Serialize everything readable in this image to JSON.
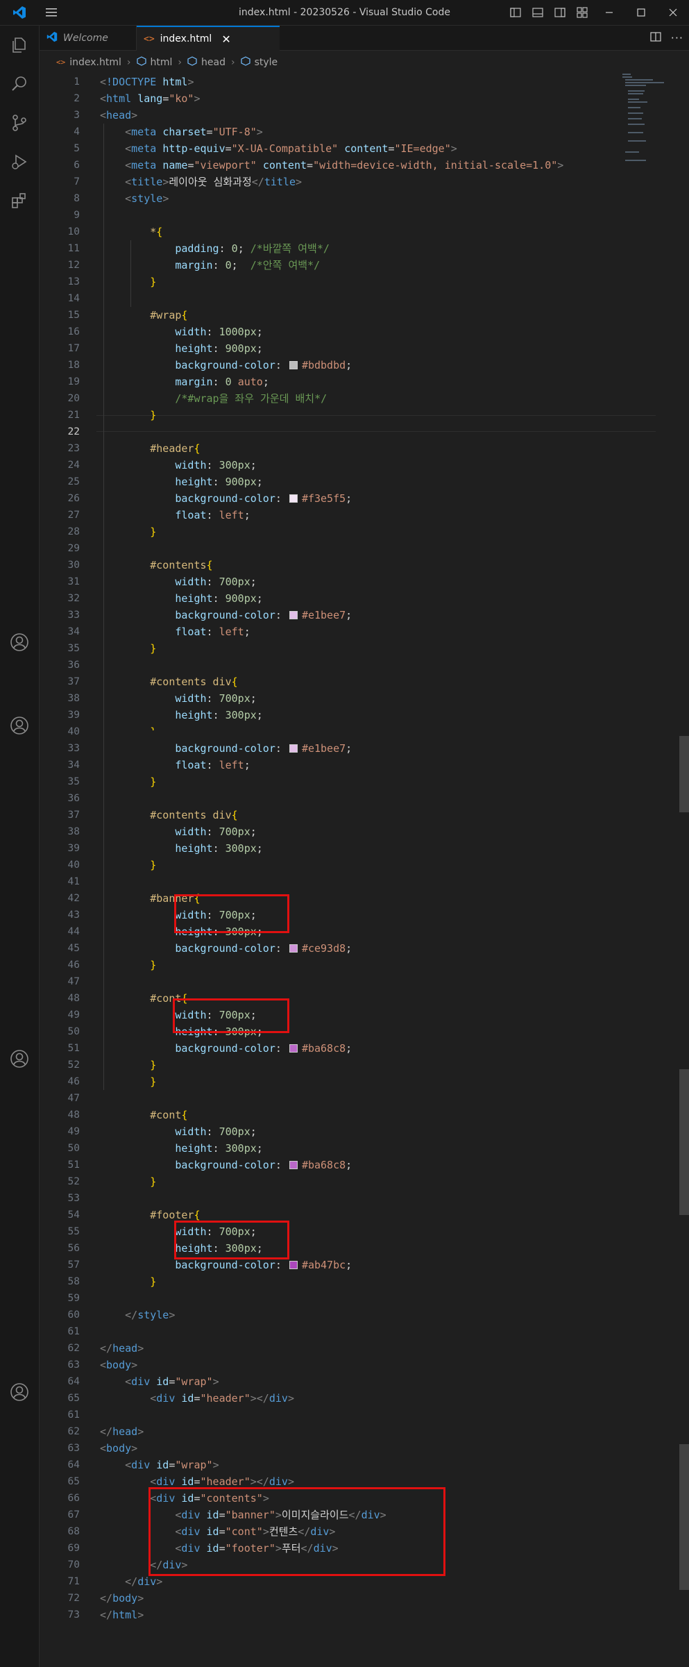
{
  "window": {
    "title": "index.html - 20230526 - Visual Studio Code"
  },
  "tabs": [
    {
      "label": "Welcome",
      "active": false
    },
    {
      "label": "index.html",
      "active": true
    }
  ],
  "breadcrumb": [
    "index.html",
    "html",
    "head",
    "style"
  ],
  "colors": {
    "accent": "#0078d4",
    "highlight_box": "#e01010"
  },
  "editor": {
    "lines": [
      {
        "n": "1",
        "html": "<span class='t'>&lt;</span><span class='tg'>!DOCTYPE</span> <span class='at'>html</span><span class='t'>&gt;</span>"
      },
      {
        "n": "2",
        "html": "<span class='t'>&lt;</span><span class='tg'>html</span> <span class='at'>lang</span><span class='pl'>=</span><span class='st'>\"ko\"</span><span class='t'>&gt;</span>"
      },
      {
        "n": "3",
        "html": "<span class='t'>&lt;</span><span class='tg'>head</span><span class='t'>&gt;</span>"
      },
      {
        "n": "4",
        "html": "    <span class='t'>&lt;</span><span class='tg'>meta</span> <span class='at'>charset</span><span class='pl'>=</span><span class='st'>\"UTF-8\"</span><span class='t'>&gt;</span>"
      },
      {
        "n": "5",
        "html": "    <span class='t'>&lt;</span><span class='tg'>meta</span> <span class='at'>http-equiv</span><span class='pl'>=</span><span class='st'>\"X-UA-Compatible\"</span> <span class='at'>content</span><span class='pl'>=</span><span class='st'>\"IE=edge\"</span><span class='t'>&gt;</span>"
      },
      {
        "n": "6",
        "html": "    <span class='t'>&lt;</span><span class='tg'>meta</span> <span class='at'>name</span><span class='pl'>=</span><span class='st'>\"viewport\"</span> <span class='at'>content</span><span class='pl'>=</span><span class='st'>\"width=device-width, initial-scale=1.0\"</span><span class='t'>&gt;</span>"
      },
      {
        "n": "7",
        "html": "    <span class='t'>&lt;</span><span class='tg'>title</span><span class='t'>&gt;</span><span class='pl'>레이아웃 심화과정</span><span class='t'>&lt;/</span><span class='tg'>title</span><span class='t'>&gt;</span>"
      },
      {
        "n": "8",
        "html": "    <span class='t'>&lt;</span><span class='tg'>style</span><span class='t'>&gt;</span>"
      },
      {
        "n": "9",
        "html": ""
      },
      {
        "n": "10",
        "html": "        <span class='sel'>*</span><span class='br'>{</span>"
      },
      {
        "n": "11",
        "html": "            <span class='pr'>padding</span><span class='pl'>: </span><span class='nu'>0</span><span class='pl'>; </span><span class='cm'>/*바깥쪽 여백*/</span>"
      },
      {
        "n": "12",
        "html": "            <span class='pr'>margin</span><span class='pl'>: </span><span class='nu'>0</span><span class='pl'>;  </span><span class='cm'>/*안쪽 여백*/</span>"
      },
      {
        "n": "13",
        "html": "        <span class='br'>}</span>"
      },
      {
        "n": "14",
        "html": ""
      },
      {
        "n": "15",
        "html": "        <span class='sel'>#wrap</span><span class='br'>{</span>"
      },
      {
        "n": "16",
        "html": "            <span class='pr'>width</span><span class='pl'>: </span><span class='nu'>1000px</span><span class='pl'>;</span>"
      },
      {
        "n": "17",
        "html": "            <span class='pr'>height</span><span class='pl'>: </span><span class='nu'>900px</span><span class='pl'>;</span>"
      },
      {
        "n": "18",
        "html": "            <span class='pr'>background-color</span><span class='pl'>: </span><span class='sw' style='background:#bdbdbd'></span><span class='st'>#bdbdbd</span><span class='pl'>;</span>"
      },
      {
        "n": "19",
        "html": "            <span class='pr'>margin</span><span class='pl'>: </span><span class='nu'>0</span><span class='pl'> </span><span class='kw'>auto</span><span class='pl'>;</span>"
      },
      {
        "n": "20",
        "html": "            <span class='cm'>/*#wrap을 좌우 가운데 배치*/</span>"
      },
      {
        "n": "21",
        "html": "        <span class='br'>}</span>"
      },
      {
        "n": "22",
        "html": "",
        "cur": true
      },
      {
        "n": "23",
        "html": "        <span class='sel'>#header</span><span class='br'>{</span>"
      },
      {
        "n": "24",
        "html": "            <span class='pr'>width</span><span class='pl'>: </span><span class='nu'>300px</span><span class='pl'>;</span>"
      },
      {
        "n": "25",
        "html": "            <span class='pr'>height</span><span class='pl'>: </span><span class='nu'>900px</span><span class='pl'>;</span>"
      },
      {
        "n": "26",
        "html": "            <span class='pr'>background-color</span><span class='pl'>: </span><span class='sw' style='background:#f3e5f5'></span><span class='st'>#f3e5f5</span><span class='pl'>;</span>"
      },
      {
        "n": "27",
        "html": "            <span class='pr'>float</span><span class='pl'>: </span><span class='kw'>left</span><span class='pl'>;</span>"
      },
      {
        "n": "28",
        "html": "        <span class='br'>}</span>"
      },
      {
        "n": "29",
        "html": ""
      },
      {
        "n": "30",
        "html": "        <span class='sel'>#contents</span><span class='br'>{</span>"
      },
      {
        "n": "31",
        "html": "            <span class='pr'>width</span><span class='pl'>: </span><span class='nu'>700px</span><span class='pl'>;</span>"
      },
      {
        "n": "32",
        "html": "            <span class='pr'>height</span><span class='pl'>: </span><span class='nu'>900px</span><span class='pl'>;</span>"
      },
      {
        "n": "33",
        "html": "            <span class='pr'>background-color</span><span class='pl'>: </span><span class='sw' style='background:#e1bee7'></span><span class='st'>#e1bee7</span><span class='pl'>;</span>"
      },
      {
        "n": "34",
        "html": "            <span class='pr'>float</span><span class='pl'>: </span><span class='kw'>left</span><span class='pl'>;</span>"
      },
      {
        "n": "35",
        "html": "        <span class='br'>}</span>"
      },
      {
        "n": "36",
        "html": ""
      },
      {
        "n": "37",
        "html": "        <span class='sel'>#contents div</span><span class='br'>{</span>"
      },
      {
        "n": "38",
        "html": "            <span class='pr'>width</span><span class='pl'>: </span><span class='nu'>700px</span><span class='pl'>;</span>"
      },
      {
        "n": "39",
        "html": "            <span class='pr'>height</span><span class='pl'>: </span><span class='nu'>300px</span><span class='pl'>;</span>"
      },
      {
        "n": "40",
        "html": "        <span class='br'>}</span>",
        "glitch": true
      },
      {
        "n": "33",
        "html": "            <span class='pr'>background-color</span><span class='pl'>: </span><span class='sw' style='background:#e1bee7'></span><span class='st'>#e1bee7</span><span class='pl'>;</span>"
      },
      {
        "n": "34",
        "html": "            <span class='pr'>float</span><span class='pl'>: </span><span class='kw'>left</span><span class='pl'>;</span>"
      },
      {
        "n": "35",
        "html": "        <span class='br'>}</span>"
      },
      {
        "n": "36",
        "html": ""
      },
      {
        "n": "37",
        "html": "        <span class='sel'>#contents div</span><span class='br'>{</span>"
      },
      {
        "n": "38",
        "html": "            <span class='pr'>width</span><span class='pl'>: </span><span class='nu'>700px</span><span class='pl'>;</span>"
      },
      {
        "n": "39",
        "html": "            <span class='pr'>height</span><span class='pl'>: </span><span class='nu'>300px</span><span class='pl'>;</span>"
      },
      {
        "n": "40",
        "html": "        <span class='br'>}</span>"
      },
      {
        "n": "41",
        "html": ""
      },
      {
        "n": "42",
        "html": "        <span class='sel'>#banner</span><span class='br'>{</span>"
      },
      {
        "n": "43",
        "html": "            <span class='pr'>width</span><span class='pl'>: </span><span class='nu'>700px</span><span class='pl'>;</span>"
      },
      {
        "n": "44",
        "html": "            <span class='pr'>height</span><span class='pl'>: </span><span class='nu'>300px</span><span class='pl'>;</span>"
      },
      {
        "n": "45",
        "html": "            <span class='pr'>background-color</span><span class='pl'>: </span><span class='sw' style='background:#ce93d8'></span><span class='st'>#ce93d8</span><span class='pl'>;</span>"
      },
      {
        "n": "46",
        "html": "        <span class='br'>}</span>"
      },
      {
        "n": "47",
        "html": ""
      },
      {
        "n": "48",
        "html": "        <span class='sel'>#cont</span><span class='br'>{</span>"
      },
      {
        "n": "49",
        "html": "            <span class='pr'>width</span><span class='pl'>: </span><span class='nu'>700px</span><span class='pl'>;</span>"
      },
      {
        "n": "50",
        "html": "            <span class='pr'>height</span><span class='pl'>: </span><span class='nu'>300px</span><span class='pl'>;</span>"
      },
      {
        "n": "51",
        "html": "            <span class='pr'>background-color</span><span class='pl'>: </span><span class='sw' style='background:#ba68c8'></span><span class='st'>#ba68c8</span><span class='pl'>;</span>"
      },
      {
        "n": "52",
        "html": "        <span class='br'>}</span>"
      },
      {
        "n": "46",
        "html": "        <span class='br'>}</span>"
      },
      {
        "n": "47",
        "html": ""
      },
      {
        "n": "48",
        "html": "        <span class='sel'>#cont</span><span class='br'>{</span>"
      },
      {
        "n": "49",
        "html": "            <span class='pr'>width</span><span class='pl'>: </span><span class='nu'>700px</span><span class='pl'>;</span>"
      },
      {
        "n": "50",
        "html": "            <span class='pr'>height</span><span class='pl'>: </span><span class='nu'>300px</span><span class='pl'>;</span>"
      },
      {
        "n": "51",
        "html": "            <span class='pr'>background-color</span><span class='pl'>: </span><span class='sw' style='background:#ba68c8'></span><span class='st'>#ba68c8</span><span class='pl'>;</span>"
      },
      {
        "n": "52",
        "html": "        <span class='br'>}</span>"
      },
      {
        "n": "53",
        "html": ""
      },
      {
        "n": "54",
        "html": "        <span class='sel'>#footer</span><span class='br'>{</span>"
      },
      {
        "n": "55",
        "html": "            <span class='pr'>width</span><span class='pl'>: </span><span class='nu'>700px</span><span class='pl'>;</span>"
      },
      {
        "n": "56",
        "html": "            <span class='pr'>height</span><span class='pl'>: </span><span class='nu'>300px</span><span class='pl'>;</span>"
      },
      {
        "n": "57",
        "html": "            <span class='pr'>background-color</span><span class='pl'>: </span><span class='sw' style='background:#ab47bc'></span><span class='st'>#ab47bc</span><span class='pl'>;</span>"
      },
      {
        "n": "58",
        "html": "        <span class='br'>}</span>"
      },
      {
        "n": "59",
        "html": ""
      },
      {
        "n": "60",
        "html": "    <span class='t'>&lt;/</span><span class='tg'>style</span><span class='t'>&gt;</span>"
      },
      {
        "n": "61",
        "html": ""
      },
      {
        "n": "62",
        "html": "<span class='t'>&lt;/</span><span class='tg'>head</span><span class='t'>&gt;</span>"
      },
      {
        "n": "63",
        "html": "<span class='t'>&lt;</span><span class='tg'>body</span><span class='t'>&gt;</span>"
      },
      {
        "n": "64",
        "html": "    <span class='t'>&lt;</span><span class='tg'>div</span> <span class='at'>id</span><span class='pl'>=</span><span class='st'>\"wrap\"</span><span class='t'>&gt;</span>"
      },
      {
        "n": "65",
        "html": "        <span class='t'>&lt;</span><span class='tg'>div</span> <span class='at'>id</span><span class='pl'>=</span><span class='st'>\"header\"</span><span class='t'>&gt;&lt;/</span><span class='tg'>div</span><span class='t'>&gt;</span>"
      },
      {
        "n": "61",
        "html": ""
      },
      {
        "n": "62",
        "html": "<span class='t'>&lt;/</span><span class='tg'>head</span><span class='t'>&gt;</span>"
      },
      {
        "n": "63",
        "html": "<span class='t'>&lt;</span><span class='tg'>body</span><span class='t'>&gt;</span>"
      },
      {
        "n": "64",
        "html": "    <span class='t'>&lt;</span><span class='tg'>div</span> <span class='at'>id</span><span class='pl'>=</span><span class='st'>\"wrap\"</span><span class='t'>&gt;</span>"
      },
      {
        "n": "65",
        "html": "        <span class='t'>&lt;</span><span class='tg'>div</span> <span class='at'>id</span><span class='pl'>=</span><span class='st'>\"header\"</span><span class='t'>&gt;&lt;/</span><span class='tg'>div</span><span class='t'>&gt;</span>"
      },
      {
        "n": "66",
        "html": "        <span class='t'>&lt;</span><span class='tg'>div</span> <span class='at'>id</span><span class='pl'>=</span><span class='st'>\"contents\"</span><span class='t'>&gt;</span>"
      },
      {
        "n": "67",
        "html": "            <span class='t'>&lt;</span><span class='tg'>div</span> <span class='at'>id</span><span class='pl'>=</span><span class='st'>\"banner\"</span><span class='t'>&gt;</span><span class='pl'>이미지슬라이드</span><span class='t'>&lt;/</span><span class='tg'>div</span><span class='t'>&gt;</span>"
      },
      {
        "n": "68",
        "html": "            <span class='t'>&lt;</span><span class='tg'>div</span> <span class='at'>id</span><span class='pl'>=</span><span class='st'>\"cont\"</span><span class='t'>&gt;</span><span class='pl'>컨텐츠</span><span class='t'>&lt;/</span><span class='tg'>div</span><span class='t'>&gt;</span>"
      },
      {
        "n": "69",
        "html": "            <span class='t'>&lt;</span><span class='tg'>div</span> <span class='at'>id</span><span class='pl'>=</span><span class='st'>\"footer\"</span><span class='t'>&gt;</span><span class='pl'>푸터</span><span class='t'>&lt;/</span><span class='tg'>div</span><span class='t'>&gt;</span>"
      },
      {
        "n": "70",
        "html": "        <span class='t'>&lt;/</span><span class='tg'>div</span><span class='t'>&gt;</span>"
      },
      {
        "n": "71",
        "html": "    <span class='t'>&lt;/</span><span class='tg'>div</span><span class='t'>&gt;</span>"
      },
      {
        "n": "72",
        "html": "<span class='t'>&lt;/</span><span class='tg'>body</span><span class='t'>&gt;</span>"
      },
      {
        "n": "73",
        "html": "<span class='t'>&lt;/</span><span class='tg'>html</span><span class='t'>&gt;</span>"
      }
    ]
  }
}
